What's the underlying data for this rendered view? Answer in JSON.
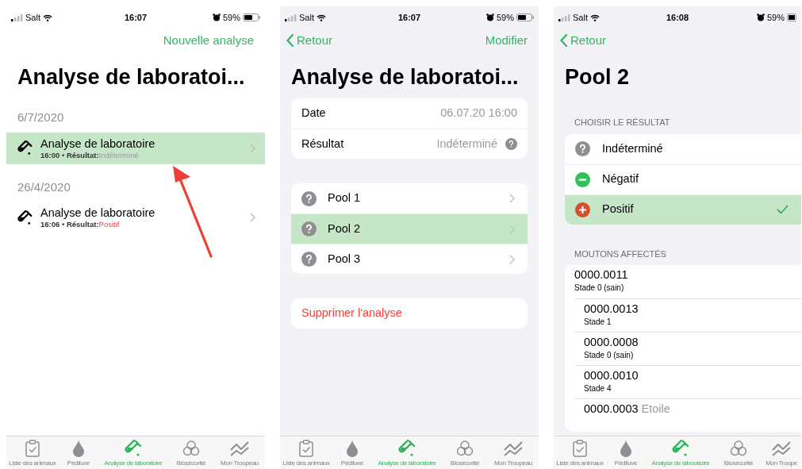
{
  "screens": [
    {
      "kind": "list",
      "status_bar": {
        "carrier": "Salt",
        "time": "16:07",
        "battery": "59%"
      },
      "nav": {
        "action": "Nouvelle analyse"
      },
      "title": "Analyse de laboratoi...",
      "sections": [
        {
          "header": "6/7/2020",
          "rows": [
            {
              "title": "Analyse de laboratoire",
              "subtitle": "16:00 • Résultat:",
              "result": "Indéterminé",
              "kind": "undetermined",
              "selected": true
            }
          ]
        },
        {
          "header": "26/4/2020",
          "rows": [
            {
              "title": "Analyse de laboratoire",
              "subtitle": "16:06 • Résultat:",
              "result": "Positif",
              "kind": "positive",
              "selected": false
            }
          ]
        }
      ],
      "tabs": [
        {
          "label": "Liste des animaux",
          "selected": false
        },
        {
          "label": "Pédiluve",
          "selected": false
        },
        {
          "label": "Analyse de laboratoire",
          "selected": true
        },
        {
          "label": "Biosécurité",
          "selected": false
        },
        {
          "label": "Mon Troupeau",
          "selected": false
        }
      ]
    },
    {
      "kind": "detail",
      "status_bar": {
        "carrier": "Salt",
        "time": "16:07",
        "battery": "59%"
      },
      "nav": {
        "back": "Retour",
        "action": "Modifier"
      },
      "title": "Analyse de laboratoi...",
      "info": [
        {
          "label": "Date",
          "value": "06.07.20 16:00"
        },
        {
          "label": "Résultat",
          "value": "Indéterminé",
          "kind": "undetermined"
        }
      ],
      "pools": [
        {
          "label": "Pool 1",
          "kind": "undetermined",
          "selected": false
        },
        {
          "label": "Pool 2",
          "kind": "undetermined",
          "selected": true
        },
        {
          "label": "Pool 3",
          "kind": "undetermined",
          "selected": false
        }
      ],
      "delete_button": "Supprimer l'analyse",
      "tabs": [
        {
          "label": "Liste des animaux",
          "selected": false
        },
        {
          "label": "Pédiluve",
          "selected": false
        },
        {
          "label": "Analyse de laboratoire",
          "selected": true
        },
        {
          "label": "Biosécurité",
          "selected": false
        },
        {
          "label": "Mon Troupeau",
          "selected": false
        }
      ]
    },
    {
      "kind": "picker",
      "status_bar": {
        "carrier": "Salt",
        "time": "16:08",
        "battery": "59%"
      },
      "nav": {
        "back": "Retour"
      },
      "title": "Pool 2",
      "options_header": "CHOISIR LE RÉSULTAT",
      "options": [
        {
          "label": "Indéterminé",
          "kind": "undetermined",
          "selected": false
        },
        {
          "label": "Négatif",
          "kind": "negative",
          "selected": false
        },
        {
          "label": "Positif",
          "kind": "positive",
          "selected": true
        }
      ],
      "sheep_header": "MOUTONS AFFECTÉS",
      "sheep": [
        {
          "id": "0000.0011",
          "stage": "Stade 0 (sain)"
        },
        {
          "id": "0000.0013",
          "stage": "Stade 1"
        },
        {
          "id": "0000.0008",
          "stage": "Stade 0 (sain)"
        },
        {
          "id": "0000.0010",
          "stage": "Stade 4"
        },
        {
          "id": "0000.0003",
          "tag": "Etoile"
        }
      ],
      "tabs": [
        {
          "label": "Liste des animaux",
          "selected": false
        },
        {
          "label": "Pédiluve",
          "selected": false
        },
        {
          "label": "Analyse de laboratoire",
          "selected": true
        },
        {
          "label": "Biosécurité",
          "selected": false
        },
        {
          "label": "Mon Troupe",
          "selected": false
        }
      ]
    }
  ]
}
